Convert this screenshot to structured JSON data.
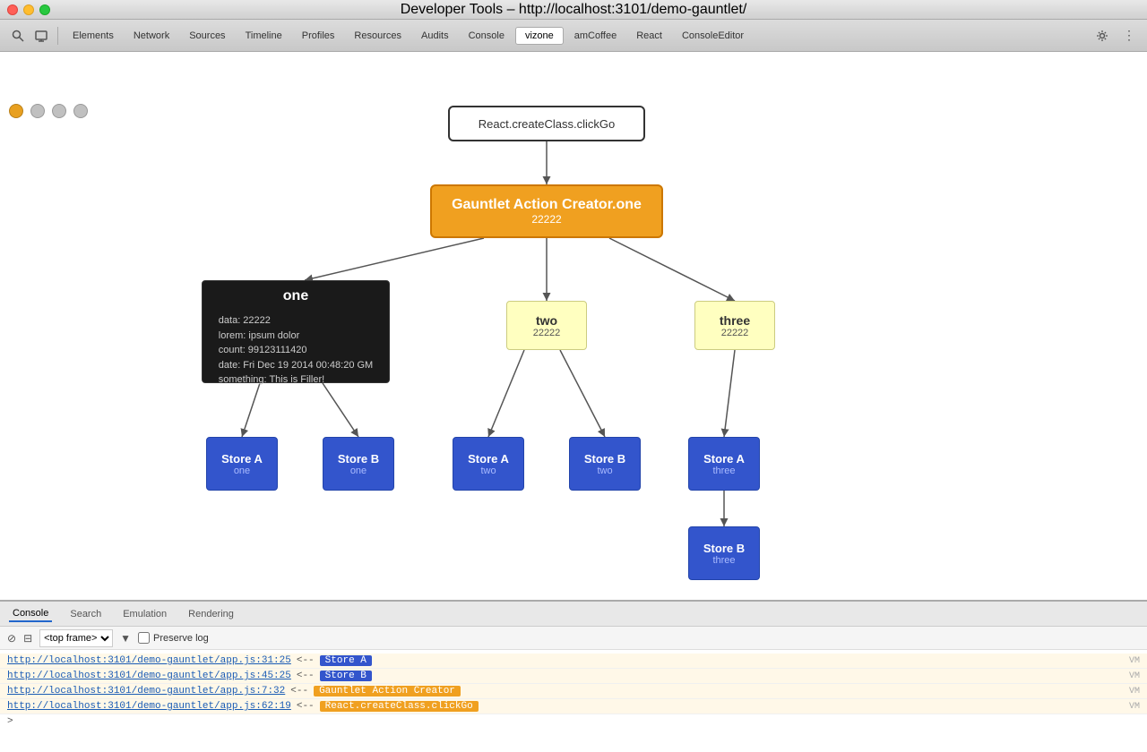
{
  "titlebar": {
    "title": "Developer Tools – http://localhost:3101/demo-gauntlet/"
  },
  "toolbar": {
    "tabs": [
      {
        "label": "Elements",
        "active": false
      },
      {
        "label": "Network",
        "active": false
      },
      {
        "label": "Sources",
        "active": false
      },
      {
        "label": "Timeline",
        "active": false
      },
      {
        "label": "Profiles",
        "active": false
      },
      {
        "label": "Resources",
        "active": false
      },
      {
        "label": "Audits",
        "active": false
      },
      {
        "label": "Console",
        "active": false
      },
      {
        "label": "vizone",
        "active": true
      },
      {
        "label": "amCoffee",
        "active": false
      },
      {
        "label": "React",
        "active": false
      },
      {
        "label": "ConsoleEditor",
        "active": false
      }
    ]
  },
  "nodes": {
    "root": {
      "label": "React.createClass.clickGo"
    },
    "gac": {
      "title": "Gauntlet Action Creator.one",
      "sub": "22222"
    },
    "one": {
      "title": "one",
      "data": [
        "data: 22222",
        "lorem: ipsum dolor",
        "count: 99123111420",
        "date: Fri Dec 19 2014 00:48:20 GM",
        "something: This is Filler!"
      ]
    },
    "two": {
      "title": "two",
      "sub": "22222"
    },
    "three": {
      "title": "three",
      "sub": "22222"
    },
    "store_a_one": {
      "title": "Store A",
      "sub": "one"
    },
    "store_b_one": {
      "title": "Store B",
      "sub": "one"
    },
    "store_a_two": {
      "title": "Store A",
      "sub": "two"
    },
    "store_b_two": {
      "title": "Store B",
      "sub": "two"
    },
    "store_a_three": {
      "title": "Store A",
      "sub": "three"
    },
    "store_b_three": {
      "title": "Store B",
      "sub": "three"
    }
  },
  "console": {
    "tabs": [
      "Console",
      "Search",
      "Emulation",
      "Rendering"
    ],
    "active_tab": "Console",
    "toolbar": {
      "frame": "<top frame>",
      "preserve_log": "Preserve log"
    },
    "logs": [
      {
        "link": "http://localhost:3101/demo-gauntlet/app.js:31:25",
        "arrow": "<--",
        "label": "Store A",
        "type": "blue"
      },
      {
        "link": "http://localhost:3101/demo-gauntlet/app.js:45:25",
        "arrow": "<--",
        "label": "Store B",
        "type": "blue"
      },
      {
        "link": "http://localhost:3101/demo-gauntlet/app.js:7:32",
        "arrow": "<--",
        "label": "Gauntlet Action Creator",
        "type": "orange"
      },
      {
        "link": "http://localhost:3101/demo-gauntlet/app.js:62:19",
        "arrow": "<--",
        "label": "React.createClass.clickGo",
        "type": "orange"
      }
    ]
  }
}
